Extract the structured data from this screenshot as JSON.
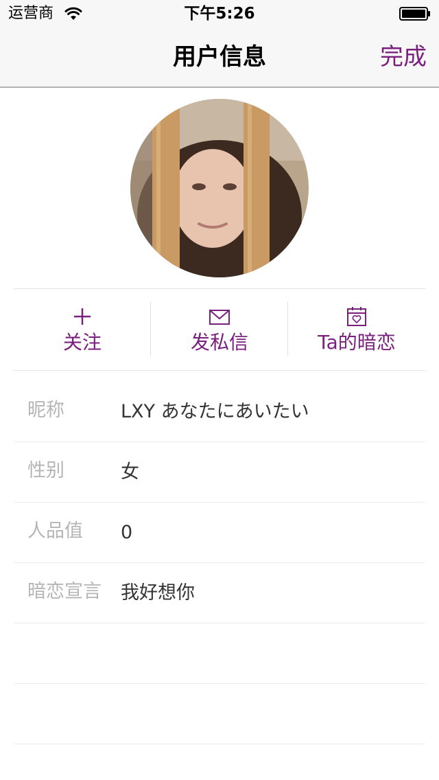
{
  "status_bar": {
    "carrier": "运营商",
    "time": "下午5:26",
    "wifi_icon": "wifi-icon",
    "battery_icon": "battery-icon"
  },
  "nav": {
    "title": "用户信息",
    "done_label": "完成"
  },
  "actions": [
    {
      "label": "关注",
      "icon": "plus-icon"
    },
    {
      "label": "发私信",
      "icon": "envelope-icon"
    },
    {
      "label": "Ta的暗恋",
      "icon": "calendar-heart-icon"
    }
  ],
  "profile": {
    "rows": [
      {
        "key": "昵称",
        "value": "LXY あなたにあいたい"
      },
      {
        "key": "性别",
        "value": "女"
      },
      {
        "key": "人品值",
        "value": "0"
      },
      {
        "key": "暗恋宣言",
        "value": "我好想你"
      }
    ]
  },
  "theme": {
    "accent": "#7a1f7e",
    "key_text": "#b5b5b5",
    "value_text": "#333333"
  }
}
